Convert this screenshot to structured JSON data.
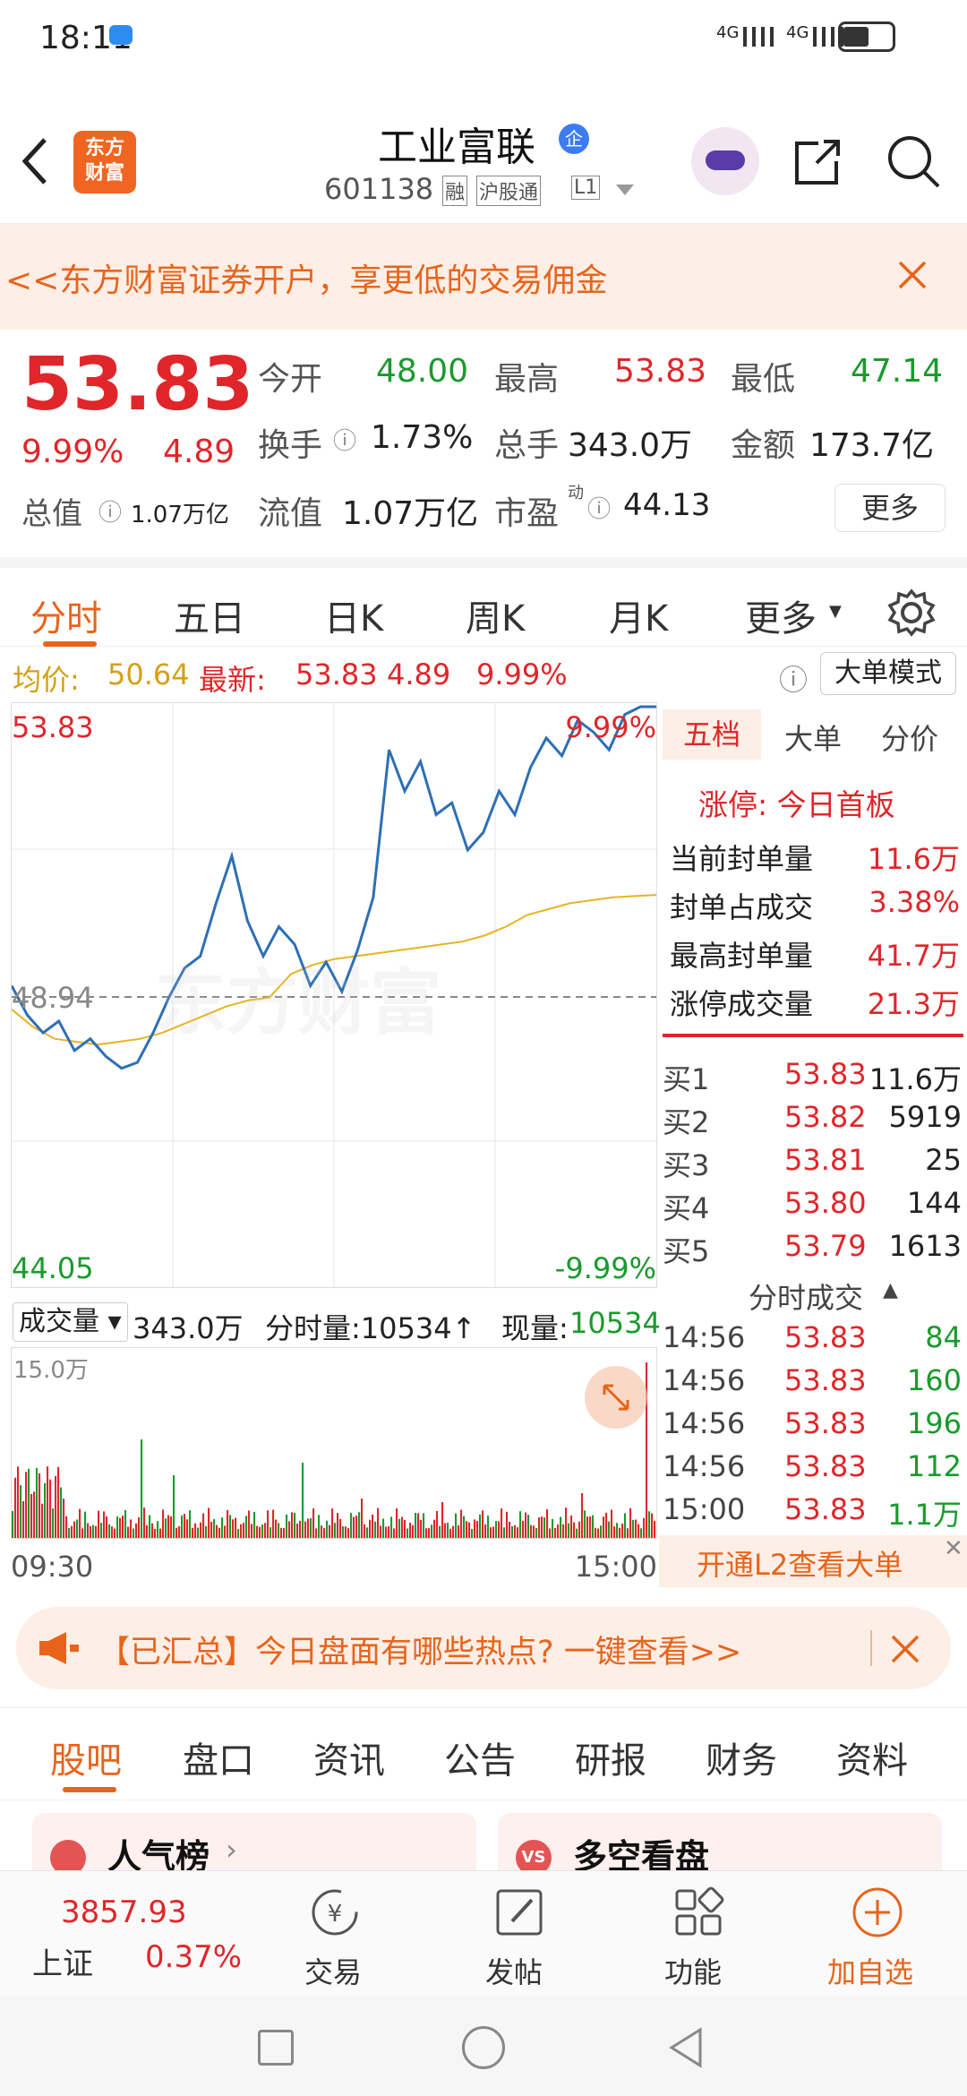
{
  "status": {
    "time": "18:11",
    "signal1": "4G",
    "signal2": "4G"
  },
  "header": {
    "logo_line1": "东方",
    "logo_line2": "财富",
    "title": "工业富联",
    "badge": "企",
    "code": "601138",
    "tag1": "融",
    "tag2": "沪股通",
    "tag3": "L1"
  },
  "promo": {
    "text": "东方财富证券开户，享更低的交易佣金>>"
  },
  "quote": {
    "price": "53.83",
    "change_pct": "9.99%",
    "change": "4.89",
    "open_label": "今开",
    "open": "48.00",
    "high_label": "最高",
    "high": "53.83",
    "low_label": "最低",
    "low": "47.14",
    "turnover_label": "换手",
    "turnover": "1.73%",
    "volume_label": "总手",
    "volume": "343.0万",
    "amount_label": "金额",
    "amount": "173.7亿",
    "mktcap_label": "总值",
    "mktcap": "1.07万亿",
    "float_label": "流值",
    "float": "1.07万亿",
    "pe_label": "市盈",
    "pe_sup": "动",
    "pe": "44.13",
    "more": "更多"
  },
  "tabs": [
    "分时",
    "五日",
    "日K",
    "周K",
    "月K",
    "更多"
  ],
  "infobar": {
    "avg_label": "均价:",
    "avg": "50.64",
    "latest_label": "最新:",
    "latest": "53.83",
    "chg": "4.89",
    "pct": "9.99%",
    "mode": "大单模式"
  },
  "chart": {
    "top_price": "53.83",
    "mid_price": "48.94",
    "bottom_price": "44.05",
    "top_pct": "9.99%",
    "bottom_pct": "-9.99%",
    "watermark": "东方财富"
  },
  "chart_data": {
    "type": "line",
    "ylim": [
      44.05,
      53.83
    ],
    "series": [
      {
        "values": [
          49.1,
          48.6,
          48.3,
          48.5,
          48.0,
          48.2,
          47.9,
          47.7,
          47.8,
          48.3,
          48.9,
          49.4,
          49.6,
          50.5,
          51.3,
          50.2,
          49.6,
          50.1,
          49.8,
          49.1,
          49.5,
          49.0,
          49.7,
          50.6,
          53.1,
          52.4,
          52.9,
          52.0,
          52.2,
          51.4,
          51.7,
          52.4,
          52.0,
          52.8,
          53.3,
          53.0,
          53.6,
          53.4,
          53.1,
          53.7,
          53.83,
          53.83
        ]
      },
      {
        "values": [
          48.7,
          48.4,
          48.2,
          48.15,
          48.1,
          48.15,
          48.2,
          48.3,
          48.45,
          48.6,
          48.75,
          48.85,
          48.9,
          49.3,
          49.45,
          49.55,
          49.6,
          49.65,
          49.7,
          49.75,
          49.8,
          49.85,
          49.95,
          50.1,
          50.3,
          50.4,
          50.5,
          50.55,
          50.6,
          50.62,
          50.64
        ]
      }
    ]
  },
  "depth": {
    "tabs": [
      "五档",
      "大单",
      "分价"
    ],
    "limit_title": "涨停: 今日首板",
    "limit_rows": [
      {
        "label": "当前封单量",
        "value": "11.6万"
      },
      {
        "label": "封单占成交",
        "value": "3.38%"
      },
      {
        "label": "最高封单量",
        "value": "41.7万"
      },
      {
        "label": "涨停成交量",
        "value": "21.3万"
      }
    ],
    "bids": [
      {
        "label": "买1",
        "price": "53.83",
        "vol": "11.6万"
      },
      {
        "label": "买2",
        "price": "53.82",
        "vol": "5919"
      },
      {
        "label": "买3",
        "price": "53.81",
        "vol": "25"
      },
      {
        "label": "买4",
        "price": "53.80",
        "vol": "144"
      },
      {
        "label": "买5",
        "price": "53.79",
        "vol": "1613"
      }
    ],
    "trades_title": "分时成交",
    "trades": [
      {
        "time": "14:56",
        "price": "53.83",
        "vol": "84"
      },
      {
        "time": "14:56",
        "price": "53.83",
        "vol": "160"
      },
      {
        "time": "14:56",
        "price": "53.83",
        "vol": "196"
      },
      {
        "time": "14:56",
        "price": "53.83",
        "vol": "112"
      },
      {
        "time": "15:00",
        "price": "53.83",
        "vol": "1.1万"
      }
    ],
    "l2": "开通L2查看大单"
  },
  "volume": {
    "label": "成交量",
    "total": "343.0万",
    "period_label": "分时量:10534↑",
    "now_label": "现量:",
    "now": "10534",
    "max": "15.0万",
    "start": "09:30",
    "end": "15:00"
  },
  "notice": {
    "text": "【已汇总】今日盘面有哪些热点? 一键查看>>"
  },
  "sections": [
    "股吧",
    "盘口",
    "资讯",
    "公告",
    "研报",
    "财务",
    "资料"
  ],
  "cards": [
    {
      "title": "人气榜"
    },
    {
      "title": "多空看盘"
    }
  ],
  "bottom": {
    "index": "3857.93",
    "index_name": "上证",
    "index_pct": "0.37%",
    "items": [
      "交易",
      "发帖",
      "功能",
      "加自选"
    ]
  }
}
